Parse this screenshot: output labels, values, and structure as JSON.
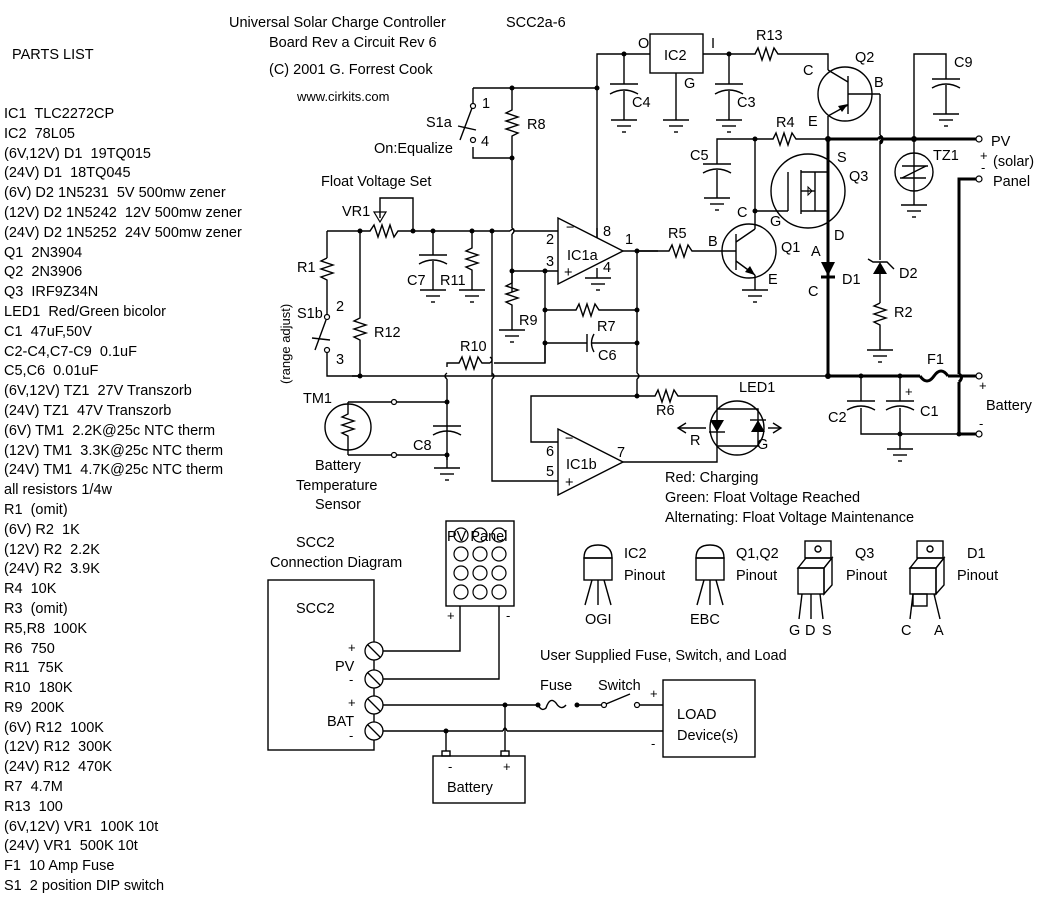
{
  "header": {
    "title": "Universal Solar Charge Controller",
    "model": "SCC2a-6",
    "revision": "Board Rev a  Circuit Rev 6",
    "copyright": "(C) 2001  G. Forrest Cook",
    "website": "www.cirkits.com"
  },
  "parts_list": {
    "title": "PARTS LIST",
    "items": [
      "IC1  TLC2272CP",
      "IC2  78L05",
      "(6V,12V) D1  19TQ015",
      "(24V) D1  18TQ045",
      "(6V) D2 1N5231  5V 500mw zener",
      "(12V) D2 1N5242  12V 500mw zener",
      "(24V) D2 1N5252  24V 500mw zener",
      "Q1  2N3904",
      "Q2  2N3906",
      "Q3  IRF9Z34N",
      "LED1  Red/Green bicolor",
      "C1  47uF,50V",
      "C2-C4,C7-C9  0.1uF",
      "C5,C6  0.01uF",
      "(6V,12V) TZ1  27V Transzorb",
      "(24V) TZ1  47V Transzorb",
      "(6V) TM1  2.2K@25c NTC therm",
      "(12V) TM1  3.3K@25c NTC therm",
      "(24V) TM1  4.7K@25c NTC therm",
      "all resistors 1/4w",
      "R1  (omit)",
      "(6V) R2  1K",
      "(12V) R2  2.2K",
      "(24V) R2  3.9K",
      "R4  10K",
      "R3  (omit)",
      "R5,R8  100K",
      "R6  750",
      "R11  75K",
      "R10  180K",
      "R9  200K",
      "(6V) R12  100K",
      "(12V) R12  300K",
      "(24V) R12  470K",
      "R7  4.7M",
      "R13  100",
      "(6V,12V) VR1  100K 10t",
      "(24V) VR1  500K 10t",
      "F1  10 Amp Fuse",
      "S1  2 position DIP switch"
    ]
  },
  "labels": {
    "s1a": "S1a",
    "s1a_pin1": "1",
    "s1a_pin4": "4",
    "on_equalize": "On:Equalize",
    "r8": "R8",
    "float_voltage_set": "Float Voltage Set",
    "vr1": "VR1",
    "r1": "R1",
    "s1b": "S1b",
    "s1b_pin2": "2",
    "s1b_pin3": "3",
    "range_adjust": "(range adjust)",
    "r12": "R12",
    "c7": "C7",
    "r11": "R11",
    "r9": "R9",
    "r7": "R7",
    "c6": "C6",
    "r10": "R10",
    "ic1a": "IC1a",
    "pin2": "2",
    "pin3": "3",
    "pin8": "8",
    "pin1": "1",
    "pin4": "4",
    "ic2": "IC2",
    "ic2_o": "O",
    "ic2_i": "I",
    "ic2_g": "G",
    "c4": "C4",
    "c3": "C3",
    "r13": "R13",
    "q2": "Q2",
    "q2_c": "C",
    "q2_b": "B",
    "q2_e": "E",
    "c9": "C9",
    "r4": "R4",
    "c5": "C5",
    "q3": "Q3",
    "q3_s": "S",
    "q3_g": "G",
    "q3_d": "D",
    "tz1": "TZ1",
    "pv_plus": "+",
    "pv_minus": "-",
    "pv": "PV",
    "pv_solar": "(solar)",
    "pv_panel": "Panel",
    "r5": "R5",
    "q1": "Q1",
    "q1_b": "B",
    "q1_c": "C",
    "q1_e": "E",
    "d1": "D1",
    "d1_a": "A",
    "d1_c": "C",
    "d2": "D2",
    "r2": "R2",
    "f1": "F1",
    "c2": "C2",
    "c1": "C1",
    "c1_plus": "+",
    "battery": "Battery",
    "bat_plus": "+",
    "bat_minus": "-",
    "tm1": "TM1",
    "c8": "C8",
    "temp_sensor_1": "Battery",
    "temp_sensor_2": "Temperature",
    "temp_sensor_3": "Sensor",
    "ic1b": "IC1b",
    "pin6": "6",
    "pin5": "5",
    "pin7": "7",
    "r6": "R6",
    "led1": "LED1",
    "led_r": "R",
    "led_g": "G",
    "minus_sign": "−",
    "plus_sign": "+"
  },
  "led_legend": [
    "Red: Charging",
    "Green: Float Voltage Reached",
    "Alternating: Float Voltage Maintenance"
  ],
  "pinouts": [
    {
      "name": "IC2",
      "caption": "Pinout",
      "pins": "OGI"
    },
    {
      "name": "Q1,Q2",
      "caption": "Pinout",
      "pins": "EBC"
    },
    {
      "name": "Q3",
      "caption": "Pinout",
      "pins": [
        "G",
        "D",
        "S"
      ]
    },
    {
      "name": "D1",
      "caption": "Pinout",
      "pins": [
        "C",
        "A"
      ]
    }
  ],
  "connection_diagram": {
    "title_1": "SCC2",
    "title_2": "Connection Diagram",
    "box_label": "SCC2",
    "pv_label": "PV",
    "bat_label": "BAT",
    "plus": "+",
    "minus": "-",
    "pv_panel_label": "PV Panel",
    "battery_label": "Battery",
    "user_supplied": "User Supplied Fuse, Switch, and Load",
    "fuse": "Fuse",
    "switch": "Switch",
    "load_1": "LOAD",
    "load_2": "Device(s)"
  }
}
